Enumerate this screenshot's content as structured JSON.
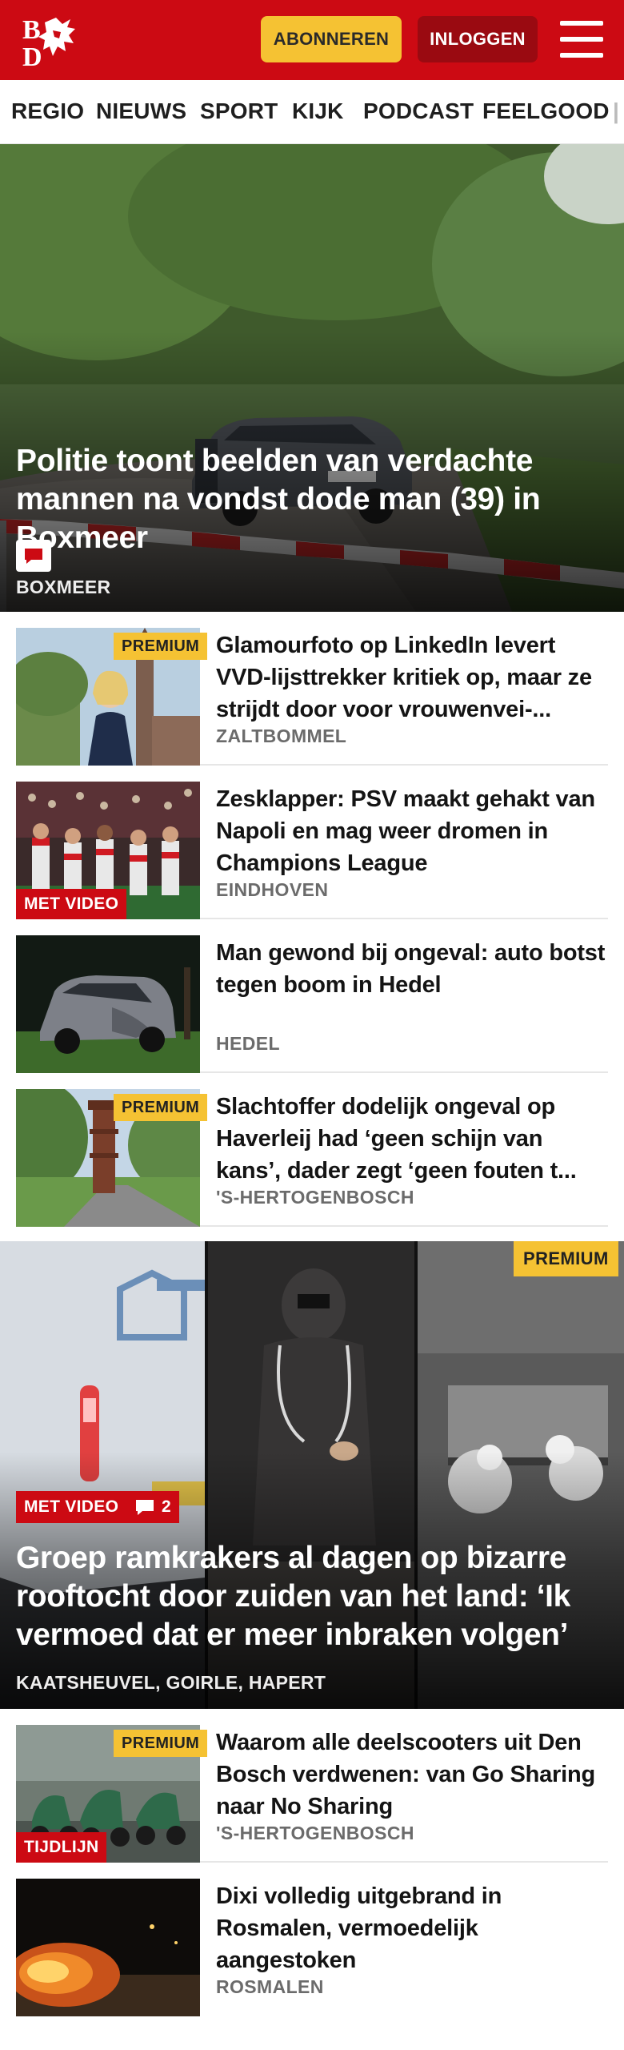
{
  "header": {
    "logo_text": "BD",
    "subscribe_label": "ABONNEREN",
    "login_label": "INLOGGEN",
    "menu_icon": "hamburger-icon",
    "brand_color": "#cc0a13",
    "accent_color": "#f5c233"
  },
  "nav": {
    "items": [
      "REGIO",
      "NIEUWS",
      "SPORT",
      "KIJK",
      "PODCAST",
      "FEELGOOD"
    ]
  },
  "top_story": {
    "icon": "comment-icon",
    "title": "Politie toont beelden van verdachte mannen na vondst dode man (39) in Boxmeer",
    "location": "BOXMEER"
  },
  "articles": [
    {
      "title": "Glamourfoto op LinkedIn levert VVD-lijsttrekker kritiek op, maar ze strijdt door voor vrouwenvei-...",
      "location": "ZALTBOMMEL",
      "premium": "PREMIUM"
    },
    {
      "title": "Zesklapper: PSV maakt gehakt van Napoli en mag weer dromen in Champions League",
      "location": "EINDHOVEN",
      "tag": "MET VIDEO"
    },
    {
      "title": "Man gewond bij ongeval: auto botst tegen boom in Hedel",
      "location": "HEDEL"
    },
    {
      "title": "Slachtoffer dodelijk ongeval op Haverleij had ‘geen schijn van kans’, dader zegt ‘geen fouten t...",
      "location": "'S-HERTOGENBOSCH",
      "premium": "PREMIUM"
    }
  ],
  "second_story": {
    "premium": "PREMIUM",
    "video_tag": "MET VIDEO",
    "comment_count": "2",
    "title": "Groep ramkrakers al dagen op bizarre rooftocht door zuiden van het land: ‘Ik vermoed dat er meer inbraken volgen’",
    "location": "KAATSHEUVEL, GOIRLE, HAPERT"
  },
  "articles2": [
    {
      "title": "Waarom alle deelscooters uit Den Bosch verdwenen: van Go Sharing naar No Sharing",
      "location": "'S-HERTOGENBOSCH",
      "premium": "PREMIUM",
      "tag": "TIJDLIJN"
    },
    {
      "title": "Dixi volledig uitgebrand in Rosmalen, vermoedelijk aangestoken",
      "location": "ROSMALEN"
    }
  ]
}
